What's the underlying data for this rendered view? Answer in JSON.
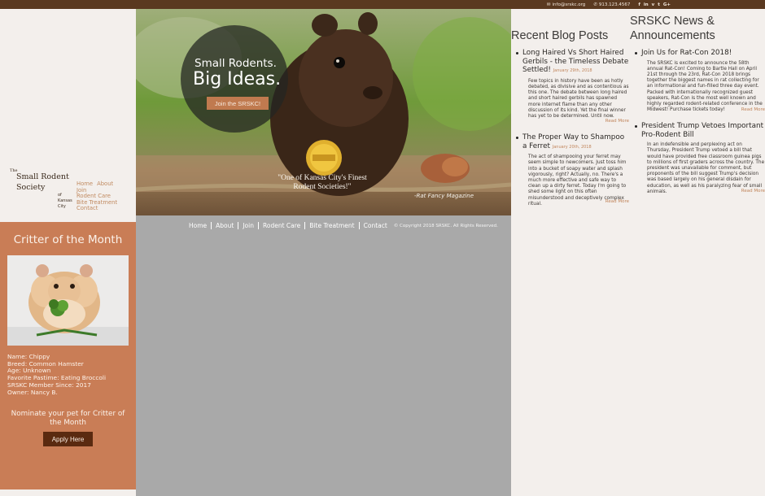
{
  "topbar": {
    "email": "info@srskc.org",
    "phone": "913.123.4567",
    "social": [
      "f",
      "in",
      "v",
      "t",
      "G+"
    ]
  },
  "logo": {
    "the": "The",
    "name_line1": "Small Rodent",
    "name_line2": "Society",
    "of_line1": "of",
    "of_line2": "Kansas",
    "of_line3": "City"
  },
  "left_nav": [
    "Home",
    "About",
    "Join",
    "Rodent Care",
    "Bite Treatment",
    "Contact"
  ],
  "hero": {
    "tagline_small": "Small Rodents.",
    "tagline_big": "Big Ideas.",
    "join_button": "Join the SRSKC!",
    "quote": "\"One of Kansas City's Finest Rodent Societies!\"",
    "attribution": "-Rat Fancy Magazine"
  },
  "footer": {
    "links": [
      "Home",
      "About",
      "Join",
      "Rodent Care",
      "Bite Treatment",
      "Contact"
    ],
    "copyright": "© Copyright 2018 SRSKC. All Rights Reserved."
  },
  "critter": {
    "title": "Critter of the Month",
    "info": [
      "Name: Chippy",
      "Breed: Common Hamster",
      "Age: Unknown",
      "Favorite Pastime: Eating Broccoli",
      "SRSKC Member Since: 2017",
      "Owner: Nancy B."
    ],
    "nominate": "Nominate your pet for Critter of the Month",
    "apply_button": "Apply Here"
  },
  "blog": {
    "heading": "Recent Blog Posts",
    "posts": [
      {
        "title": "Long Haired Vs Short Haired Gerbils - the Timeless Debate Settled!",
        "date": "January 29th, 2018",
        "body": "Few topics in history have been as hotly debated, as divisive and as contentious as this one. The debate between long haired and short haired gerbils has spawned more internet flame than any other discussion of its kind. Yet the final winner has yet to be determined. Until now.",
        "more": "Read More"
      },
      {
        "title": "The Proper Way to Shampoo a Ferret",
        "date": "January 20th, 2018",
        "body": "The act of shampooing your ferret may seem simple to newcomers. Just toss him into a bucket of soapy water and splash vigorously, right? Actually, no. There's a much more effective and safe way to clean up a dirty ferret. Today I'm going to shed some light on this often misunderstood and deceptively complex ritual.",
        "more": "Read More"
      }
    ]
  },
  "news": {
    "heading_line1": "SRSKC News &",
    "heading_line2": "Announcements",
    "posts": [
      {
        "title": "Join Us for Rat-Con 2018!",
        "body": "The SRSKC is excited to announce the 58th annual Rat-Con! Coming to Bartle Hall on April 21st through the 23rd, Rat-Con 2018 brings together the biggest names in rat collecting for an informational and fun-filled three day event. Packed with internationally recognized guest speakers, Rat-Con is the most well known and highly regarded rodent-related conference in the Midwest! Purchase tickets today!",
        "more": "Read More"
      },
      {
        "title": "President Trump Vetoes Important Pro-Rodent Bill",
        "body": "In an indefensible and perplexing act on Thursday, President Trump vetoed a bill that would have provided free classroom guinea pigs to millions of first graders across the country. The president was unavailable for comment, but proponents of the bill suggest Trump's decision was based largely on his general disdain for education, as well as his paralyzing fear of small animals.",
        "more": "Read More"
      }
    ]
  }
}
